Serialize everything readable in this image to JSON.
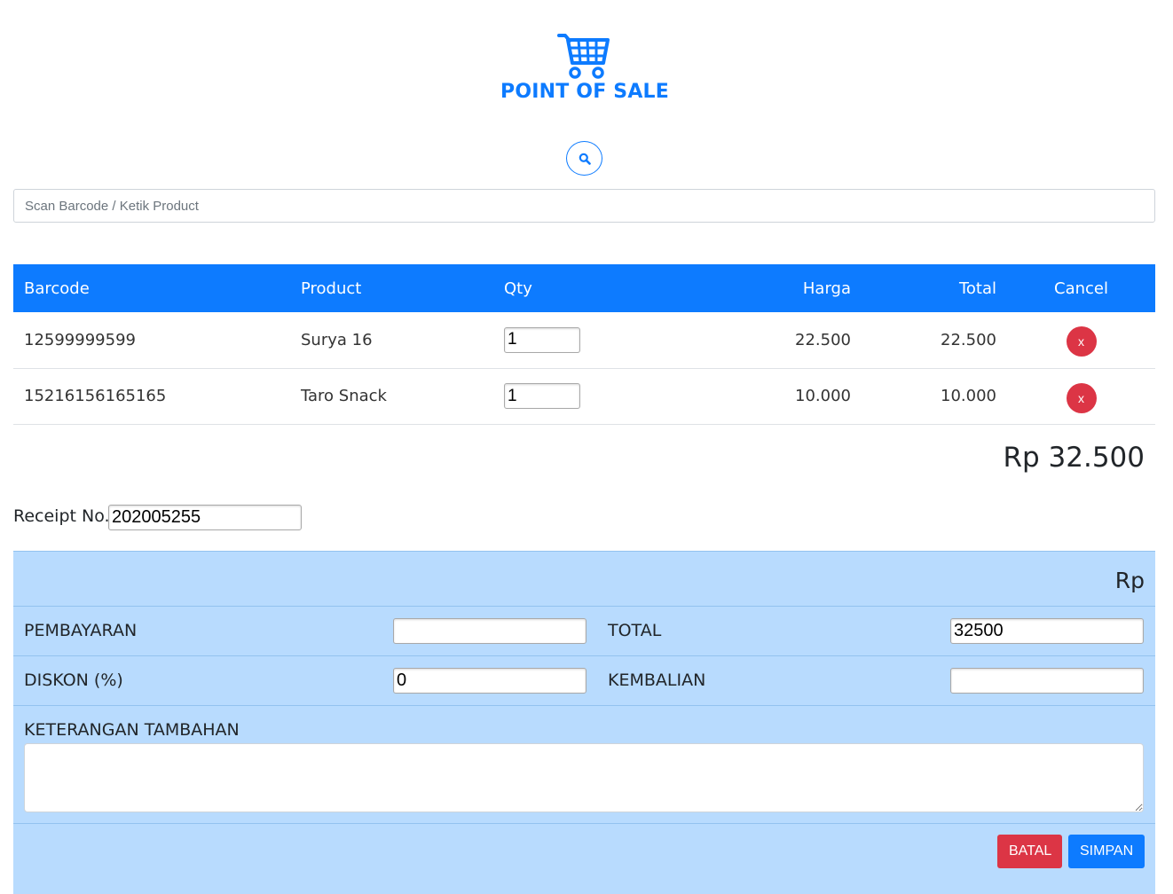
{
  "header": {
    "title": "POINT OF SALE",
    "logo_icon": "shopping-cart-icon",
    "search_icon": "search-icon"
  },
  "scan": {
    "placeholder": "Scan Barcode / Ketik Product",
    "value": ""
  },
  "table": {
    "columns": [
      "Barcode",
      "Product",
      "Qty",
      "Harga",
      "Total",
      "Cancel"
    ],
    "rows": [
      {
        "barcode": "12599999599",
        "product": "Surya 16",
        "qty": "1",
        "harga": "22.500",
        "total": "22.500",
        "cancel": "x"
      },
      {
        "barcode": "15216156165165",
        "product": "Taro Snack",
        "qty": "1",
        "harga": "10.000",
        "total": "10.000",
        "cancel": "x"
      }
    ]
  },
  "grand_total": "Rp 32.500",
  "receipt": {
    "label": "Receipt No.",
    "value": "202005255"
  },
  "payment": {
    "currency": "Rp",
    "pembayaran_label": "PEMBAYARAN",
    "pembayaran_value": "",
    "total_label": "TOTAL",
    "total_value": "32500",
    "diskon_label": "DISKON (%)",
    "diskon_value": "0",
    "kembalian_label": "KEMBALIAN",
    "kembalian_value": "",
    "keterangan_label": "KETERANGAN TAMBAHAN",
    "keterangan_value": ""
  },
  "actions": {
    "batal": "BATAL",
    "simpan": "SIMPAN"
  },
  "colors": {
    "primary": "#0d7bff",
    "danger": "#dc3545",
    "panel": "#b8dbfe"
  }
}
